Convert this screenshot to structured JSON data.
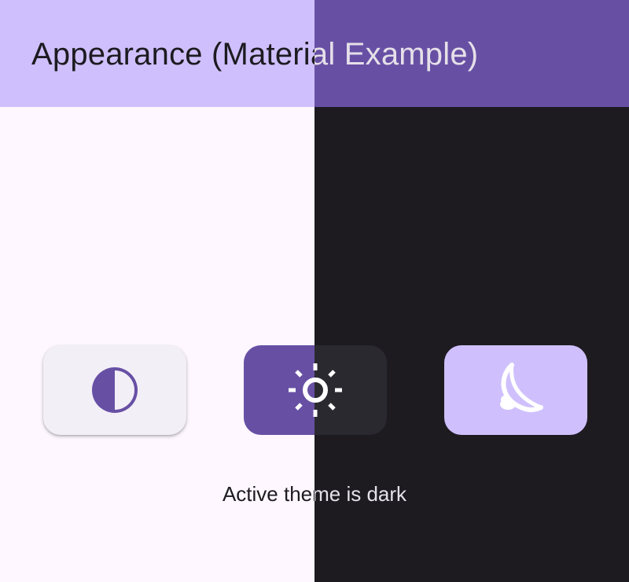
{
  "app_bar": {
    "title": "Appearance (Material Example)"
  },
  "theme_selector": {
    "options": [
      {
        "name": "system",
        "icon": "contrast-icon"
      },
      {
        "name": "light",
        "icon": "sun-icon"
      },
      {
        "name": "dark",
        "icon": "moon-icon"
      }
    ]
  },
  "status": {
    "text": "Active theme is dark"
  },
  "colors": {
    "light_background": "#fef7ff",
    "dark_background": "#1d1b20",
    "light_appbar": "#cfc0fd",
    "dark_appbar": "#6750a4",
    "primary": "#6750a4",
    "primary_container_light": "#cfc0fd",
    "surface_container_dark": "#2b2930",
    "on_surface_light": "#1d1b20",
    "on_surface_dark": "#e6e0e9"
  }
}
